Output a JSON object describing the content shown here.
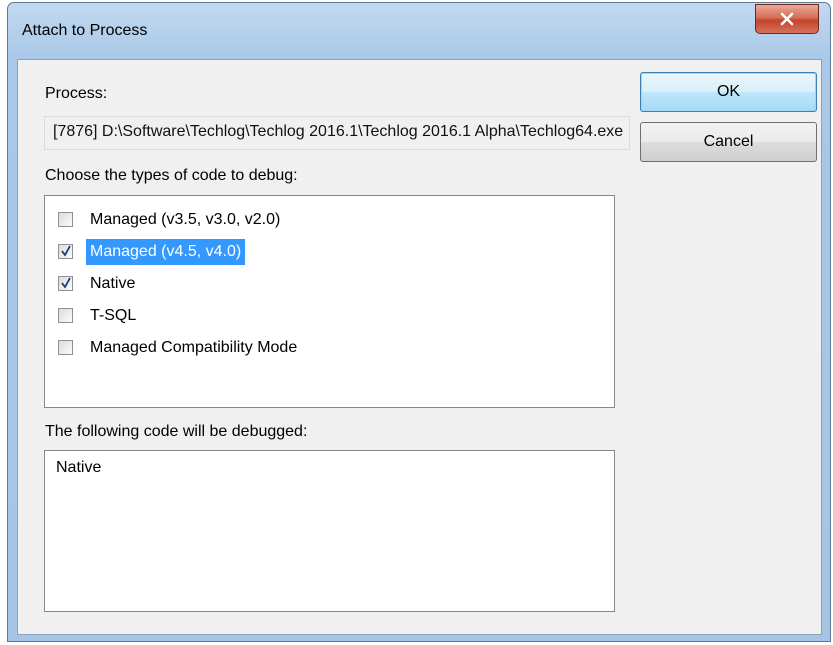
{
  "window": {
    "title": "Attach to Process"
  },
  "process": {
    "label": "Process:",
    "value": "[7876] D:\\Software\\Techlog\\Techlog 2016.1\\Techlog 2016.1 Alpha\\Techlog64.exe"
  },
  "buttons": {
    "ok": "OK",
    "cancel": "Cancel"
  },
  "code_types": {
    "label": "Choose the types of code to debug:",
    "items": [
      {
        "label": "Managed (v3.5, v3.0, v2.0)",
        "checked": false,
        "selected": false
      },
      {
        "label": "Managed (v4.5, v4.0)",
        "checked": true,
        "selected": true
      },
      {
        "label": "Native",
        "checked": true,
        "selected": false
      },
      {
        "label": "T-SQL",
        "checked": false,
        "selected": false
      },
      {
        "label": "Managed Compatibility Mode",
        "checked": false,
        "selected": false
      }
    ]
  },
  "debugged": {
    "label": "The following code will be debugged:",
    "value": "Native"
  }
}
